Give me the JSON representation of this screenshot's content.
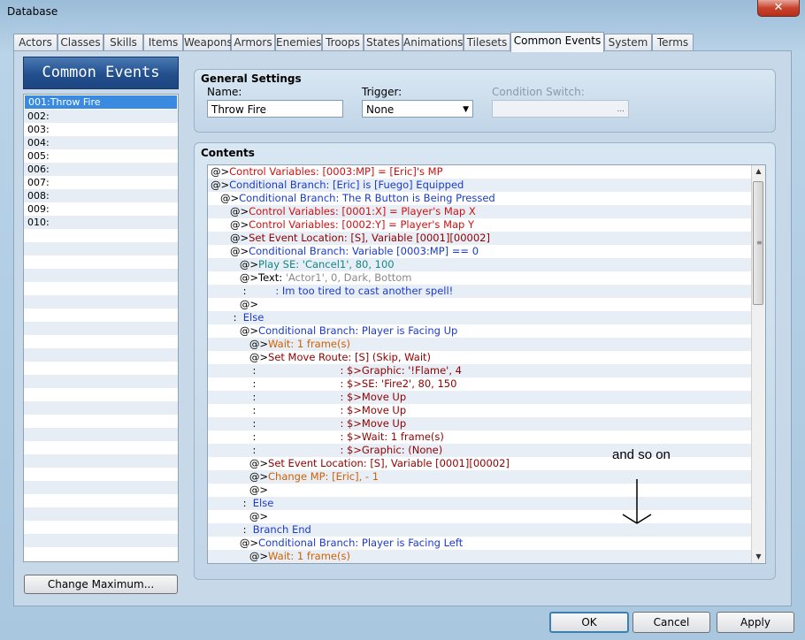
{
  "window": {
    "title": "Database",
    "close_label": "✕"
  },
  "tabs": [
    {
      "label": "Actors"
    },
    {
      "label": "Classes"
    },
    {
      "label": "Skills"
    },
    {
      "label": "Items"
    },
    {
      "label": "Weapons"
    },
    {
      "label": "Armors"
    },
    {
      "label": "Enemies"
    },
    {
      "label": "Troops"
    },
    {
      "label": "States"
    },
    {
      "label": "Animations"
    },
    {
      "label": "Tilesets"
    },
    {
      "label": "Common Events"
    },
    {
      "label": "System"
    },
    {
      "label": "Terms"
    }
  ],
  "sidebar": {
    "header": "Common Events",
    "items": [
      "001:Throw Fire",
      "002:",
      "003:",
      "004:",
      "005:",
      "006:",
      "007:",
      "008:",
      "009:",
      "010:"
    ],
    "change_max_label": "Change Maximum..."
  },
  "general": {
    "title": "General Settings",
    "name_label": "Name:",
    "name_value": "Throw Fire",
    "trigger_label": "Trigger:",
    "trigger_value": "None",
    "condition_label": "Condition Switch:",
    "condition_button": "..."
  },
  "contents": {
    "title": "Contents",
    "lines": [
      {
        "indent": "",
        "parts": [
          {
            "t": "@>",
            "c": "black"
          },
          {
            "t": "Control Variables: [0003:MP] = [Eric]'s MP",
            "c": "red"
          }
        ]
      },
      {
        "indent": "",
        "parts": [
          {
            "t": "@>",
            "c": "black"
          },
          {
            "t": "Conditional Branch: [Eric] is [Fuego] Equipped",
            "c": "blue"
          }
        ]
      },
      {
        "indent": "   ",
        "parts": [
          {
            "t": "@>",
            "c": "black"
          },
          {
            "t": "Conditional Branch: The R Button is Being Pressed",
            "c": "blue"
          }
        ]
      },
      {
        "indent": "      ",
        "parts": [
          {
            "t": "@>",
            "c": "black"
          },
          {
            "t": "Control Variables: [0001:X] = Player's Map X",
            "c": "red"
          }
        ]
      },
      {
        "indent": "      ",
        "parts": [
          {
            "t": "@>",
            "c": "black"
          },
          {
            "t": "Control Variables: [0002:Y] = Player's Map Y",
            "c": "red"
          }
        ]
      },
      {
        "indent": "      ",
        "parts": [
          {
            "t": "@>",
            "c": "black"
          },
          {
            "t": "Set Event Location: [S], Variable [0001][00002]",
            "c": "maroon"
          }
        ]
      },
      {
        "indent": "      ",
        "parts": [
          {
            "t": "@>",
            "c": "black"
          },
          {
            "t": "Conditional Branch: Variable [0003:MP] == 0",
            "c": "blue"
          }
        ]
      },
      {
        "indent": "         ",
        "parts": [
          {
            "t": "@>",
            "c": "black"
          },
          {
            "t": "Play SE: 'Cancel1', 80, 100",
            "c": "teal"
          }
        ]
      },
      {
        "indent": "         ",
        "parts": [
          {
            "t": "@>Text: ",
            "c": "black"
          },
          {
            "t": "'Actor1', 0, Dark, Bottom",
            "c": "gray"
          }
        ]
      },
      {
        "indent": "          ",
        "parts": [
          {
            "t": ":         ",
            "c": "black"
          },
          {
            "t": ": Im too tired to cast another spell!",
            "c": "blue"
          }
        ]
      },
      {
        "indent": "         ",
        "parts": [
          {
            "t": "@>",
            "c": "black"
          }
        ]
      },
      {
        "indent": "       ",
        "parts": [
          {
            "t": ":  ",
            "c": "black"
          },
          {
            "t": "Else",
            "c": "blue"
          }
        ]
      },
      {
        "indent": "         ",
        "parts": [
          {
            "t": "@>",
            "c": "black"
          },
          {
            "t": "Conditional Branch: Player is Facing Up",
            "c": "blue"
          }
        ]
      },
      {
        "indent": "            ",
        "parts": [
          {
            "t": "@>",
            "c": "black"
          },
          {
            "t": "Wait: 1 frame(s)",
            "c": "orange"
          }
        ]
      },
      {
        "indent": "            ",
        "parts": [
          {
            "t": "@>",
            "c": "black"
          },
          {
            "t": "Set Move Route: [S] (Skip, Wait)",
            "c": "maroon"
          }
        ]
      },
      {
        "indent": "             ",
        "parts": [
          {
            "t": ":                          ",
            "c": "black"
          },
          {
            "t": ": $>Graphic: '!Flame', 4",
            "c": "maroon"
          }
        ]
      },
      {
        "indent": "             ",
        "parts": [
          {
            "t": ":                          ",
            "c": "black"
          },
          {
            "t": ": $>SE: 'Fire2', 80, 150",
            "c": "maroon"
          }
        ]
      },
      {
        "indent": "             ",
        "parts": [
          {
            "t": ":                          ",
            "c": "black"
          },
          {
            "t": ": $>Move Up",
            "c": "maroon"
          }
        ]
      },
      {
        "indent": "             ",
        "parts": [
          {
            "t": ":                          ",
            "c": "black"
          },
          {
            "t": ": $>Move Up",
            "c": "maroon"
          }
        ]
      },
      {
        "indent": "             ",
        "parts": [
          {
            "t": ":                          ",
            "c": "black"
          },
          {
            "t": ": $>Move Up",
            "c": "maroon"
          }
        ]
      },
      {
        "indent": "             ",
        "parts": [
          {
            "t": ":                          ",
            "c": "black"
          },
          {
            "t": ": $>Wait: 1 frame(s)",
            "c": "maroon"
          }
        ]
      },
      {
        "indent": "             ",
        "parts": [
          {
            "t": ":                          ",
            "c": "black"
          },
          {
            "t": ": $>Graphic: (None)",
            "c": "maroon"
          }
        ]
      },
      {
        "indent": "            ",
        "parts": [
          {
            "t": "@>",
            "c": "black"
          },
          {
            "t": "Set Event Location: [S], Variable [0001][00002]",
            "c": "maroon"
          }
        ]
      },
      {
        "indent": "            ",
        "parts": [
          {
            "t": "@>",
            "c": "black"
          },
          {
            "t": "Change MP: [Eric], - 1",
            "c": "orange"
          }
        ]
      },
      {
        "indent": "            ",
        "parts": [
          {
            "t": "@>",
            "c": "black"
          }
        ]
      },
      {
        "indent": "          ",
        "parts": [
          {
            "t": ":  ",
            "c": "black"
          },
          {
            "t": "Else",
            "c": "blue"
          }
        ]
      },
      {
        "indent": "            ",
        "parts": [
          {
            "t": "@>",
            "c": "black"
          }
        ]
      },
      {
        "indent": "          ",
        "parts": [
          {
            "t": ":  ",
            "c": "black"
          },
          {
            "t": "Branch End",
            "c": "blue"
          }
        ]
      },
      {
        "indent": "         ",
        "parts": [
          {
            "t": "@>",
            "c": "black"
          },
          {
            "t": "Conditional Branch: Player is Facing Left",
            "c": "blue"
          }
        ]
      },
      {
        "indent": "            ",
        "parts": [
          {
            "t": "@>",
            "c": "black"
          },
          {
            "t": "Wait: 1 frame(s)",
            "c": "orange"
          }
        ]
      }
    ]
  },
  "annotation": "and so on",
  "buttons": {
    "ok": "OK",
    "cancel": "Cancel",
    "apply": "Apply"
  },
  "scroll": {
    "up": "▲",
    "down": "▼",
    "grip": "≡"
  },
  "dropdown_arrow": "▼"
}
